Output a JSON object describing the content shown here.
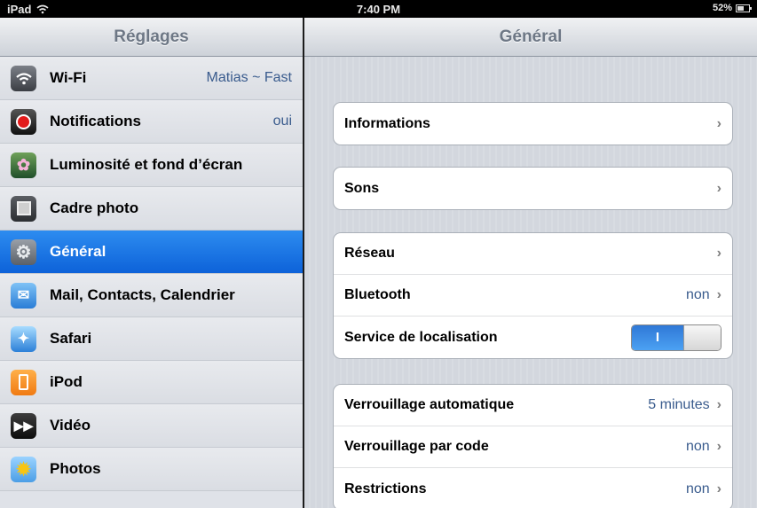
{
  "status_bar": {
    "device": "iPad",
    "time": "7:40 PM",
    "battery": "52%",
    "battery_level": 0.52
  },
  "sidebar": {
    "title": "Réglages",
    "items": [
      {
        "label": "Wi-Fi",
        "value": "Matias ~ Fast",
        "icon": "wifi-icon"
      },
      {
        "label": "Notifications",
        "value": "oui",
        "icon": "notifications-icon"
      },
      {
        "label": "Luminosité et fond d’écran",
        "value": "",
        "icon": "brightness-wallpaper-icon"
      },
      {
        "label": "Cadre photo",
        "value": "",
        "icon": "picture-frame-icon"
      },
      {
        "label": "Général",
        "value": "",
        "icon": "gear-icon",
        "selected": true
      },
      {
        "label": "Mail, Contacts, Calendrier",
        "value": "",
        "icon": "mail-icon"
      },
      {
        "label": "Safari",
        "value": "",
        "icon": "compass-icon"
      },
      {
        "label": "iPod",
        "value": "",
        "icon": "ipod-icon"
      },
      {
        "label": "Vidéo",
        "value": "",
        "icon": "clapperboard-icon"
      },
      {
        "label": "Photos",
        "value": "",
        "icon": "sunflower-icon"
      }
    ]
  },
  "main": {
    "title": "Général",
    "groups": [
      {
        "rows": [
          {
            "label": "Informations",
            "value": "",
            "control": "chevron"
          }
        ]
      },
      {
        "rows": [
          {
            "label": "Sons",
            "value": "",
            "control": "chevron"
          }
        ]
      },
      {
        "rows": [
          {
            "label": "Réseau",
            "value": "",
            "control": "chevron"
          },
          {
            "label": "Bluetooth",
            "value": "non",
            "control": "chevron"
          },
          {
            "label": "Service de localisation",
            "value": "",
            "control": "toggle",
            "toggle_state": "on",
            "toggle_text": "I"
          }
        ]
      },
      {
        "rows": [
          {
            "label": "Verrouillage automatique",
            "value": "5 minutes",
            "control": "chevron"
          },
          {
            "label": "Verrouillage par code",
            "value": "non",
            "control": "chevron"
          },
          {
            "label": "Restrictions",
            "value": "non",
            "control": "chevron"
          }
        ]
      }
    ]
  },
  "colors": {
    "selected_gradient_top": "#2d8cf0",
    "selected_gradient_bottom": "#0d62d9",
    "value_text": "#395b8d",
    "toggle_on": "#3a8ce8"
  }
}
